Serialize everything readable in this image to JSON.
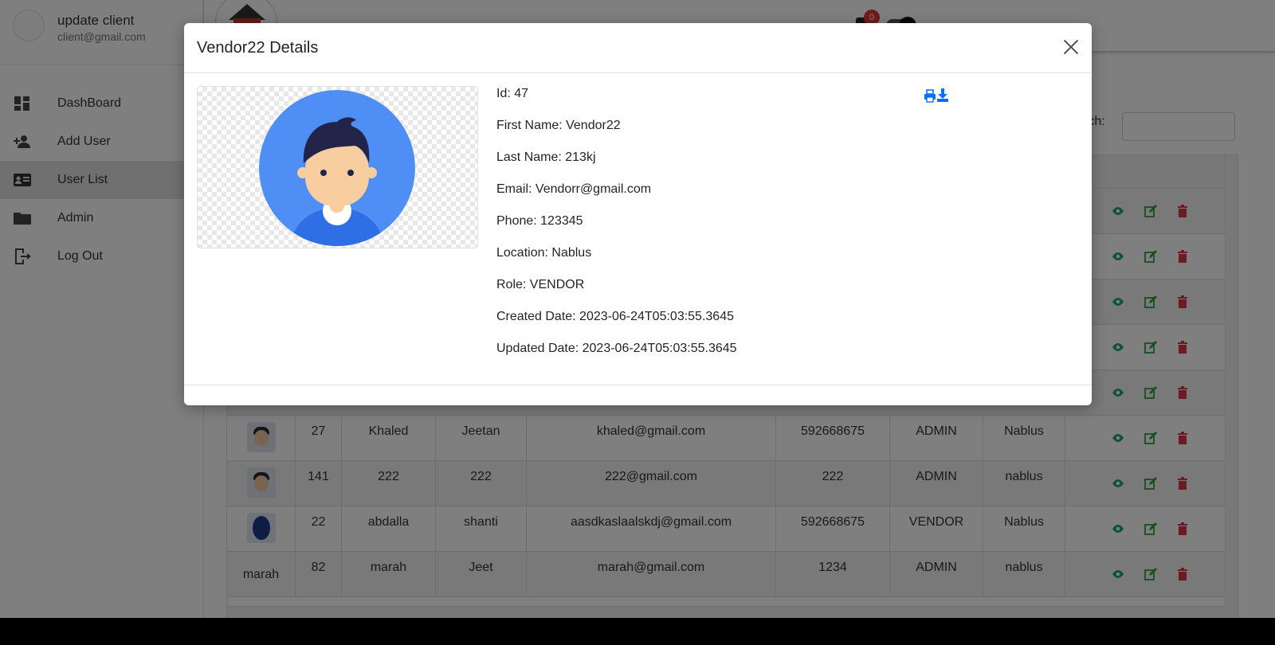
{
  "sidebar": {
    "user_name": "update client",
    "user_email": "client@gmail.com",
    "items": [
      {
        "label": "DashBoard",
        "icon": "dashboard-icon"
      },
      {
        "label": "Add User",
        "icon": "add-user-icon"
      },
      {
        "label": "User List",
        "icon": "contact-card-icon",
        "active": true
      },
      {
        "label": "Admin",
        "icon": "folder-icon"
      },
      {
        "label": "Log Out",
        "icon": "logout-icon"
      }
    ]
  },
  "header": {
    "notification_count": "0"
  },
  "content": {
    "search_label": "rch:",
    "search_value": ""
  },
  "table": {
    "rows": [
      {
        "pic": "avatar",
        "id": "27",
        "first_name": "Khaled",
        "last_name": "Jeetan",
        "email": "khaled@gmail.com",
        "phone": "592668675",
        "role": "ADMIN",
        "location": "Nablus"
      },
      {
        "pic": "avatar",
        "id": "141",
        "first_name": "222",
        "last_name": "222",
        "email": "222@gmail.com",
        "phone": "222",
        "role": "ADMIN",
        "location": "nablus"
      },
      {
        "pic": "avatar-blue",
        "id": "22",
        "first_name": "abdalla",
        "last_name": "shanti",
        "email": "aasdkaslaalskdj@gmail.com",
        "phone": "592668675",
        "role": "VENDOR",
        "location": "Nablus"
      },
      {
        "pic": "text",
        "pic_text": "marah",
        "id": "82",
        "first_name": "marah",
        "last_name": "Jeet",
        "email": "marah@gmail.com",
        "phone": "1234",
        "role": "ADMIN",
        "location": "nablus"
      }
    ]
  },
  "modal": {
    "title": "Vendor22 Details",
    "fields": [
      "Id: 47",
      "First Name: Vendor22",
      "Last Name: 213kj",
      "Email: Vendorr@gmail.com",
      "Phone: 123345",
      "Location: Nablus",
      "Role: VENDOR",
      "Created Date: 2023-06-24T05:03:55.3645",
      "Updated Date: 2023-06-24T05:03:55.3645"
    ]
  },
  "colors": {
    "view": "#1aa38a",
    "edit": "#2e9e3e",
    "delete": "#dc3545",
    "print": "#0d6efd",
    "avatar_bg": "#4f8ff5",
    "avatar_shirt": "#2f6fe6"
  }
}
